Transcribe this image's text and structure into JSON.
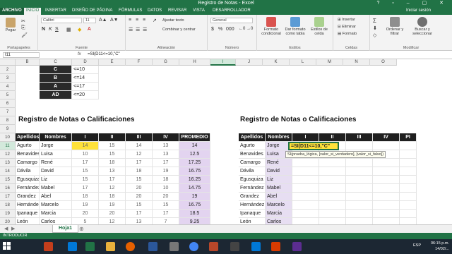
{
  "window": {
    "title": "Registro de Notas - Excel",
    "controls": "? ▫ – ▢ ✕"
  },
  "ribbon_tabs": [
    "ARCHIVO",
    "INICIO",
    "INSERTAR",
    "DISEÑO DE PÁGINA",
    "FÓRMULAS",
    "DATOS",
    "REVISAR",
    "VISTA",
    "DESARROLLADOR"
  ],
  "active_tab": "INICIO",
  "user_label": "Iniciar sesión",
  "ribbon": {
    "paste": "Pegar",
    "clipboard": "Portapapeles",
    "font_name": "Calibri",
    "font_size": "11",
    "font_group": "Fuente",
    "wrap_text": "Ajustar texto",
    "merge": "Combinar y centrar",
    "align_group": "Alineación",
    "number_format": "General",
    "number_group": "Número",
    "cond_format": "Formato condicional",
    "format_table": "Dar formato como tabla",
    "cell_styles": "Estilos de celda",
    "styles_group": "Estilos",
    "insert": "Insertar",
    "delete": "Eliminar",
    "format": "Formato",
    "cells_group": "Celdas",
    "sort": "Ordenar y filtrar",
    "find": "Buscar y seleccionar",
    "edit_group": "Modificar"
  },
  "formula_bar": {
    "name_box": "I11",
    "fx": "fx",
    "content": "=SI(D11<=10,\"C\""
  },
  "columns": [
    "A",
    "B",
    "C",
    "D",
    "E",
    "F",
    "G",
    "H",
    "I",
    "J",
    "K",
    "L",
    "M",
    "N",
    "O"
  ],
  "rows": [
    "2",
    "3",
    "4",
    "5",
    "6",
    "7",
    "8",
    "9",
    "10",
    "11",
    "12",
    "13",
    "14",
    "15",
    "16",
    "17",
    "18",
    "19",
    "20"
  ],
  "levels": [
    {
      "level": "C",
      "rule": "<=10"
    },
    {
      "level": "B",
      "rule": "<=14"
    },
    {
      "level": "A",
      "rule": "<=17"
    },
    {
      "level": "AD",
      "rule": "<=20"
    }
  ],
  "table_title": "Registro de Notas o Calificaciones",
  "headers": [
    "Apellidos",
    "Nombres",
    "I",
    "II",
    "III",
    "IV",
    "PROMEDIO"
  ],
  "students": [
    {
      "apellido": "Agurto",
      "nombre": "Jorge",
      "n": [
        14,
        15,
        14,
        13
      ],
      "prom": "14"
    },
    {
      "apellido": "Benavides",
      "nombre": "Luisa",
      "n": [
        10,
        15,
        12,
        13
      ],
      "prom": "12.5"
    },
    {
      "apellido": "Camargo",
      "nombre": "René",
      "n": [
        17,
        18,
        17,
        17
      ],
      "prom": "17.25"
    },
    {
      "apellido": "Dávila",
      "nombre": "David",
      "n": [
        15,
        13,
        18,
        19
      ],
      "prom": "16.75"
    },
    {
      "apellido": "Egusquiza",
      "nombre": "Liz",
      "n": [
        15,
        17,
        15,
        18
      ],
      "prom": "16.25"
    },
    {
      "apellido": "Fernández",
      "nombre": "Mabel",
      "n": [
        17,
        12,
        20,
        10
      ],
      "prom": "14.75"
    },
    {
      "apellido": "Grandez",
      "nombre": "Abel",
      "n": [
        18,
        18,
        20,
        20
      ],
      "prom": "19"
    },
    {
      "apellido": "Hernández",
      "nombre": "Marcelo",
      "n": [
        19,
        19,
        15,
        15
      ],
      "prom": "16.75"
    },
    {
      "apellido": "Ipanaque",
      "nombre": "Marcia",
      "n": [
        20,
        20,
        17,
        17
      ],
      "prom": "18.5"
    },
    {
      "apellido": "León",
      "nombre": "Carlos",
      "n": [
        5,
        12,
        13,
        7
      ],
      "prom": "9.25"
    }
  ],
  "right_table": {
    "title": "Registro de Notas o Calificaciones",
    "headers": [
      "Apellidos",
      "Nombres",
      "I",
      "II",
      "III",
      "IV",
      "PI"
    ],
    "active_formula": "=SI(D11<=10,\"C\"",
    "tooltip": "SI(prueba_lógica, [valor_si_verdadero], [valor_si_falso])"
  },
  "sheet_tab": "Hoja1",
  "status": "INTRODUCIR",
  "taskbar": {
    "lang": "ESP",
    "time": "06:15 p.m.",
    "date": "14/02/..."
  }
}
